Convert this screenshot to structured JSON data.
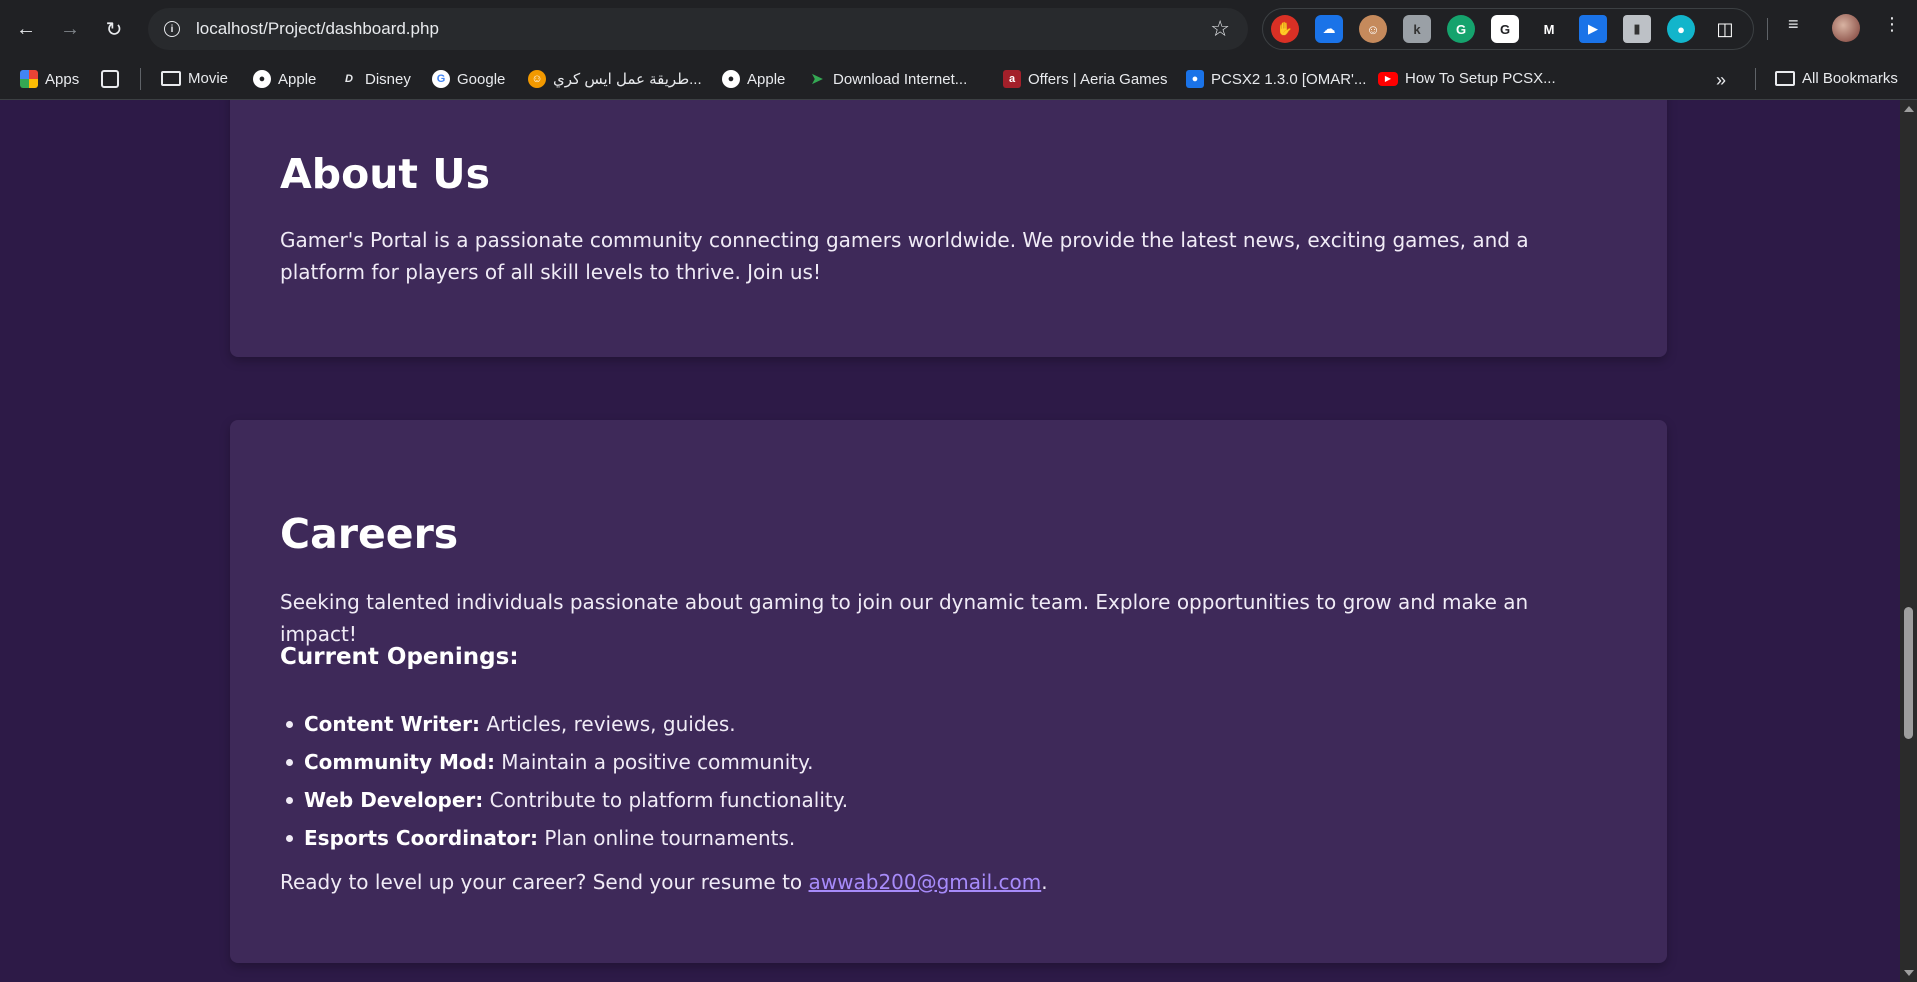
{
  "browser": {
    "url_host": "localhost",
    "url_path": "/Project/dashboard.php",
    "extensions": [
      "stop-sign-icon",
      "cloud-icon",
      "face-icon",
      "letter-k-icon",
      "grammarly-icon",
      "g-icon",
      "malwarebytes-icon",
      "screen-capture-icon",
      "device-icon",
      "globe-icon",
      "puzzle-icon"
    ],
    "bookmarks": [
      {
        "label": "Apps",
        "icon": "apps-grid-icon"
      },
      {
        "label": "",
        "icon": "grid-icon"
      },
      {
        "label": "Movie",
        "icon": "folder-icon"
      },
      {
        "label": "Apple",
        "icon": "apple-icon"
      },
      {
        "label": "Disney",
        "icon": "disney-icon"
      },
      {
        "label": "Google",
        "icon": "google-icon"
      },
      {
        "label": "طريقة عمل ايس كري...",
        "icon": "smiley-icon"
      },
      {
        "label": "Apple",
        "icon": "apple-icon"
      },
      {
        "label": "Download Internet...",
        "icon": "arrow-icon"
      },
      {
        "label": "Offers | Aeria Games",
        "icon": "aeria-icon"
      },
      {
        "label": "PCSX2 1.3.0 [OMAR'...",
        "icon": "pcsx2-icon"
      },
      {
        "label": "How To Setup PCSX...",
        "icon": "youtube-icon"
      }
    ],
    "all_bookmarks": "All Bookmarks",
    "colors": {
      "chrome_bg": "#202124",
      "omnibox_bg": "#282a2d"
    }
  },
  "about": {
    "title": "About Us",
    "body": "Gamer's Portal is a passionate community connecting gamers worldwide. We provide the latest news, exciting games, and a platform for players of all skill levels to thrive. Join us!"
  },
  "careers": {
    "title": "Careers",
    "intro": "Seeking talented individuals passionate about gaming to join our dynamic team. Explore opportunities to grow and make an impact!",
    "openings_title": "Current Openings:",
    "openings": [
      {
        "role": "Content Writer:",
        "desc": " Articles, reviews, guides."
      },
      {
        "role": "Community Mod:",
        "desc": " Maintain a positive community."
      },
      {
        "role": "Web Developer:",
        "desc": " Contribute to platform functionality."
      },
      {
        "role": "Esports Coordinator:",
        "desc": " Plan online tournaments."
      }
    ],
    "cta_prefix": "Ready to level up your career? Send your resume to ",
    "email": "awwab200@gmail.com",
    "cta_suffix": "."
  },
  "colors": {
    "page_bg": "#2d1a47",
    "card_bg": "#3e2959",
    "link": "#a78bfa"
  }
}
